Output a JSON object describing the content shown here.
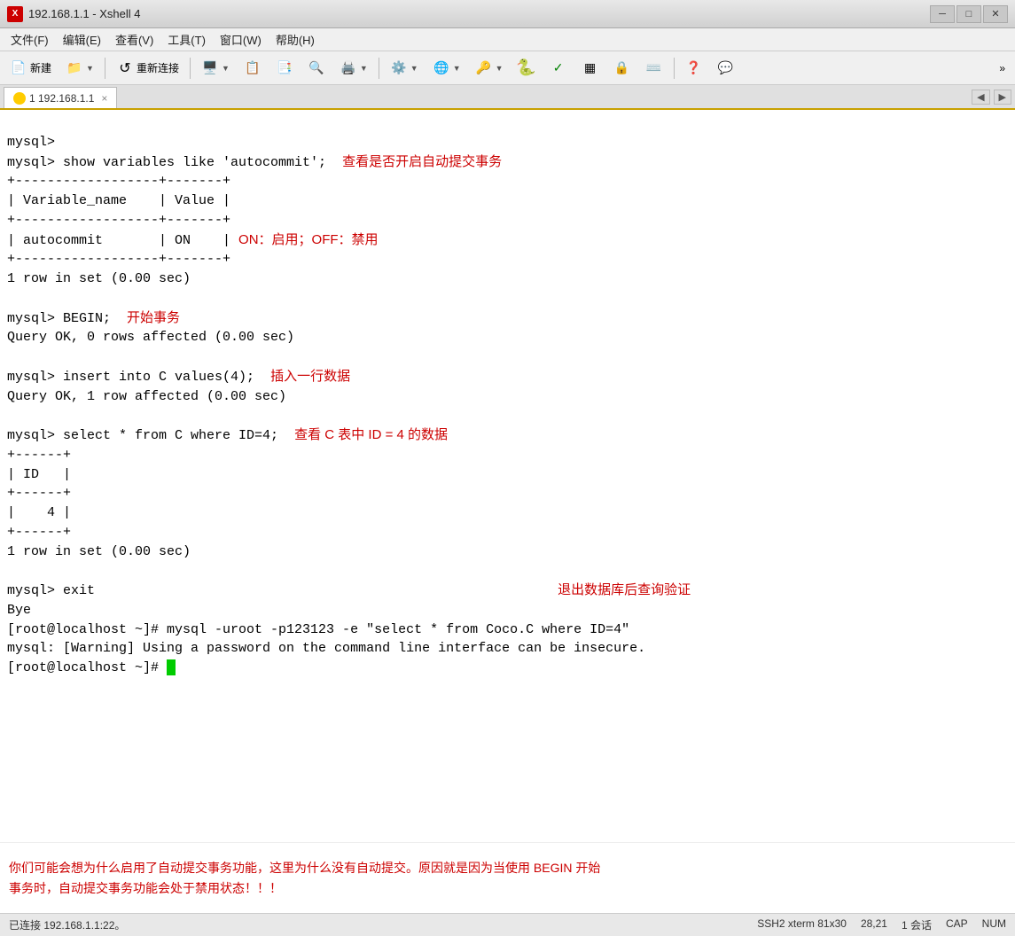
{
  "titlebar": {
    "icon_label": "X",
    "title": "192.168.1.1 - Xshell 4",
    "minimize": "─",
    "maximize": "□",
    "close": "✕"
  },
  "menubar": {
    "items": [
      "文件(F)",
      "编辑(E)",
      "查看(V)",
      "工具(T)",
      "窗口(W)",
      "帮助(H)"
    ]
  },
  "toolbar": {
    "buttons": [
      {
        "label": "新建",
        "icon": "📄"
      },
      {
        "label": "",
        "icon": "📁",
        "has_arrow": true
      },
      {
        "label": "重新连接",
        "icon": "🔗"
      },
      {
        "label": "",
        "icon": "🖥️",
        "has_arrow": true
      },
      {
        "label": "",
        "icon": "📋"
      },
      {
        "label": "",
        "icon": "📑"
      },
      {
        "label": "",
        "icon": "🔍"
      },
      {
        "label": "",
        "icon": "🖨️",
        "has_arrow": true
      },
      {
        "label": "",
        "icon": "⚙️",
        "has_arrow": true
      },
      {
        "label": "",
        "icon": "🌐",
        "has_arrow": true
      },
      {
        "label": "",
        "icon": "🔑",
        "has_arrow": true
      },
      {
        "label": "",
        "icon": "🐍"
      },
      {
        "label": "",
        "icon": "✓"
      },
      {
        "label": "",
        "icon": "▦"
      },
      {
        "label": "",
        "icon": "🔒"
      },
      {
        "label": "",
        "icon": "⌨️"
      },
      {
        "label": "",
        "icon": "❓"
      },
      {
        "label": "",
        "icon": "💬"
      }
    ]
  },
  "tab": {
    "label": "1 192.168.1.1",
    "close": "×"
  },
  "terminal": {
    "lines": [
      {
        "text": "mysql>",
        "type": "normal"
      },
      {
        "text": "mysql> show variables like 'autocommit';",
        "type": "normal",
        "comment": " 查看是否开启自动提交事务"
      },
      {
        "text": "+------------------+-------+",
        "type": "normal"
      },
      {
        "text": "| Variable_name    | Value |",
        "type": "normal"
      },
      {
        "text": "+------------------+-------+",
        "type": "normal"
      },
      {
        "text": "| autocommit       | ON    |",
        "type": "normal",
        "comment": " ON：启用；OFF：禁用"
      },
      {
        "text": "+------------------+-------+",
        "type": "normal"
      },
      {
        "text": "1 row in set (0.00 sec)",
        "type": "normal"
      },
      {
        "text": "",
        "type": "blank"
      },
      {
        "text": "mysql> BEGIN;",
        "type": "normal",
        "comment": " 开始事务"
      },
      {
        "text": "Query OK, 0 rows affected (0.00 sec)",
        "type": "normal"
      },
      {
        "text": "",
        "type": "blank"
      },
      {
        "text": "mysql> insert into C values(4);",
        "type": "normal",
        "comment": "  插入一行数据"
      },
      {
        "text": "Query OK, 1 row affected (0.00 sec)",
        "type": "normal"
      },
      {
        "text": "",
        "type": "blank"
      },
      {
        "text": "mysql> select * from C where ID=4;",
        "type": "normal",
        "comment": "  查看 C 表中 ID = 4 的数据"
      },
      {
        "text": "+------+",
        "type": "normal"
      },
      {
        "text": "| ID   |",
        "type": "normal"
      },
      {
        "text": "+------+",
        "type": "normal"
      },
      {
        "text": "|    4 |",
        "type": "normal"
      },
      {
        "text": "+------+",
        "type": "normal"
      },
      {
        "text": "1 row in set (0.00 sec)",
        "type": "normal"
      },
      {
        "text": "",
        "type": "blank"
      },
      {
        "text": "mysql> exit",
        "type": "normal"
      },
      {
        "text": "Bye",
        "type": "normal"
      },
      {
        "text": "[root@localhost ~]# mysql -uroot -p123123 -e \"select * from Coco.C where ID=4\"",
        "type": "normal"
      },
      {
        "text": "mysql: [Warning] Using a password on the command line interface can be insecure.",
        "type": "normal"
      },
      {
        "text": "[root@localhost ~]# ",
        "type": "normal",
        "cursor": true
      }
    ],
    "exit_comment": "退出数据库后查询验证",
    "annotation": "你们可能会想为什么启用了自动提交事务功能，这里为什么没有自动提交。原因就是因为当使用 BEGIN 开始\n事务时，自动提交事务功能会处于禁用状态！！！"
  },
  "statusbar": {
    "left": "已连接 192.168.1.1:22。",
    "items": [
      "SSH2  xterm  81x30",
      "28,21",
      "1 会话"
    ],
    "right_items": [
      "CAP",
      "NUM"
    ]
  }
}
